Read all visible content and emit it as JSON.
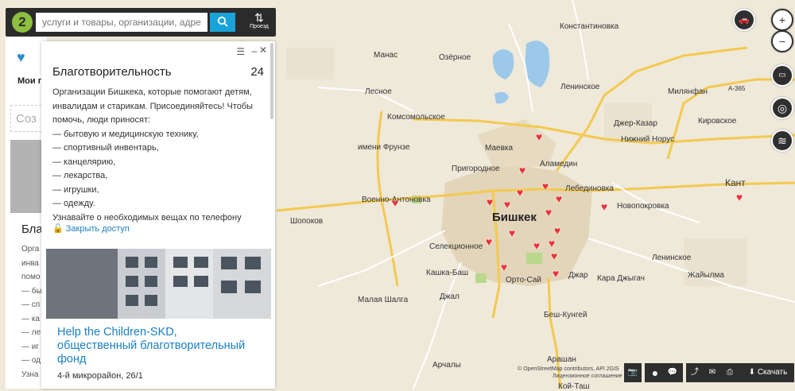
{
  "search": {
    "logo": "2",
    "placeholder": "услуги и товары, организации, адреса",
    "route_label": "Проезд"
  },
  "left_panel": {
    "my_label": "Мои п",
    "create_label": "Соз",
    "item_title": "Благ",
    "item_lines": [
      "Орга",
      "инва",
      "помо",
      "— бы",
      "— сп",
      "— ка",
      "— ле",
      "— иг",
      "— од",
      "Узна"
    ]
  },
  "card": {
    "title": "Благотворительность",
    "count": "24",
    "description": [
      "Организации Бишкека, которые помогают детям,",
      "инвалидам и старикам. Присоединяйтесь! Чтобы",
      "помочь, люди приносят:",
      "— бытовую и медицинскую технику,",
      "— спортивный инвентарь,",
      "— канцелярию,",
      "— лекарства,",
      "— игрушки,",
      "— одежду.",
      "Узнавайте о необходимых вещах по телефону"
    ],
    "close_access": "Закрыть доступ",
    "org_name": "Help the Children-SKD, общественный благотворительный фонд",
    "org_address": "4-й микрорайон, 26/1"
  },
  "map": {
    "labels": [
      "Манас",
      "Озёрное",
      "Константиновка",
      "Лесное",
      "Ленинское",
      "Милянфан",
      "А-365",
      "Комсомольское",
      "Джер-Казар",
      "Кировское",
      "Нижний Норус",
      "Маевка",
      "Аламедин",
      "имени Фрунзе",
      "Пригородное",
      "Кант",
      "Лебединовка",
      "Военно-Антоновка",
      "Новопокровка",
      "Бишкек",
      "Шопоков",
      "Селекционное",
      "Ленинское",
      "Кашка-Баш",
      "Орто-Сай",
      "Джар",
      "Кара Джыгач",
      "Жайылма",
      "Малая Шалга",
      "Джал",
      "Беш-Кунгей",
      "Арашан",
      "Арчалы",
      "Кой-Таш"
    ],
    "heart_icon": "heart-marker"
  },
  "controls": {
    "zoom_in": "+",
    "zoom_out": "−"
  },
  "bottom": {
    "attribution": "© OpenStreetMap contributors, API 2GIS",
    "license": "Лицензионное соглашение",
    "download": "Скачать"
  },
  "colors": {
    "accent": "#1aa3d9",
    "marker": "#e8323c",
    "link": "#1a7fc1",
    "brand": "#8cbf3f",
    "road": "#f3c94f",
    "water": "#9cc9ea",
    "urban": "#e0d3b8"
  }
}
